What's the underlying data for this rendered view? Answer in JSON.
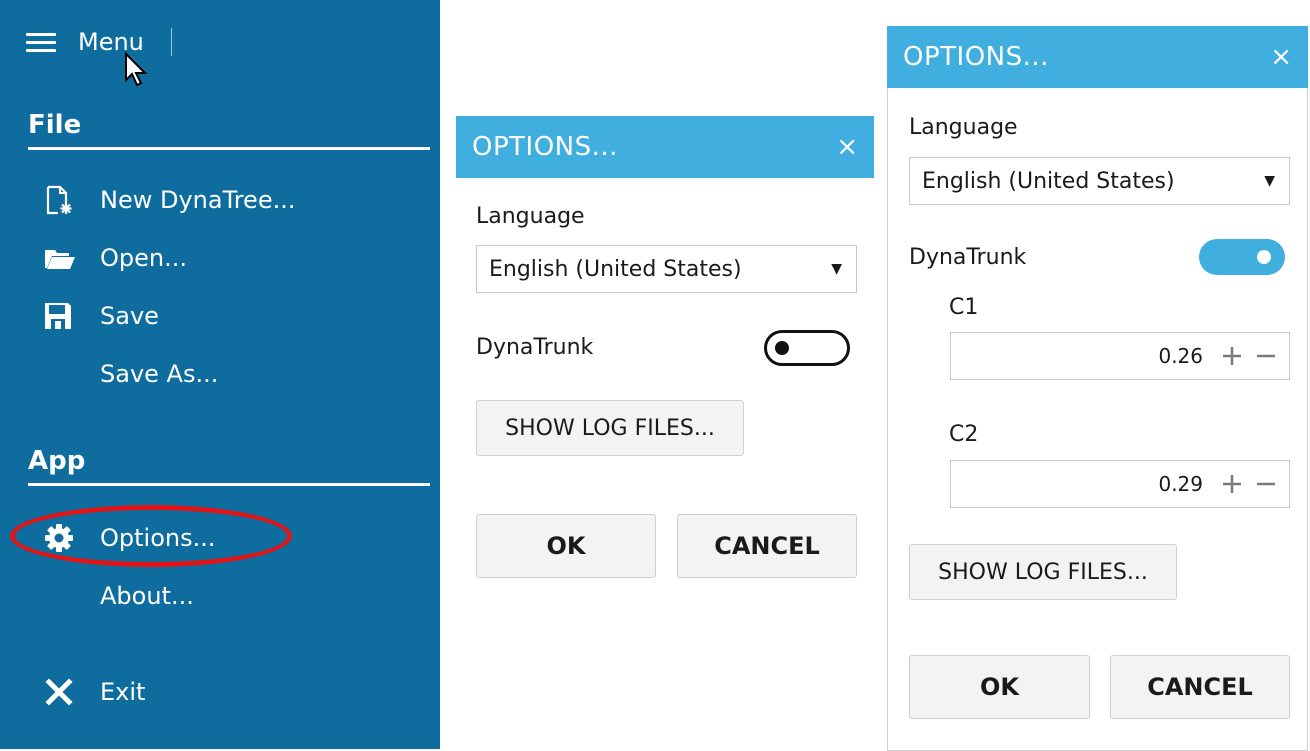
{
  "menu": {
    "title": "Menu",
    "sections": [
      {
        "title": "File"
      },
      {
        "title": "App"
      }
    ],
    "items": {
      "new": "New DynaTree...",
      "open": "Open...",
      "save": "Save",
      "save_as": "Save As...",
      "options": "Options...",
      "about": "About...",
      "exit": "Exit"
    },
    "highlight_color": "#e41414",
    "background": "#0e6d9e"
  },
  "dialog_left": {
    "title": "OPTIONS...",
    "close_icon": "×",
    "language_label": "Language",
    "language_value": "English (United States)",
    "dynatrunk_label": "DynaTrunk",
    "dynatrunk_on": false,
    "show_logs": "SHOW LOG FILES...",
    "ok": "OK",
    "cancel": "CANCEL"
  },
  "dialog_right": {
    "title": "OPTIONS...",
    "close_icon": "×",
    "language_label": "Language",
    "language_value": "English (United States)",
    "dynatrunk_label": "DynaTrunk",
    "dynatrunk_on": true,
    "c1_label": "C1",
    "c1_value": "0.26",
    "c2_label": "C2",
    "c2_value": "0.29",
    "show_logs": "SHOW LOG FILES...",
    "ok": "OK",
    "cancel": "CANCEL"
  },
  "colors": {
    "titlebar": "#41aee0",
    "accent": "#41aee0"
  }
}
